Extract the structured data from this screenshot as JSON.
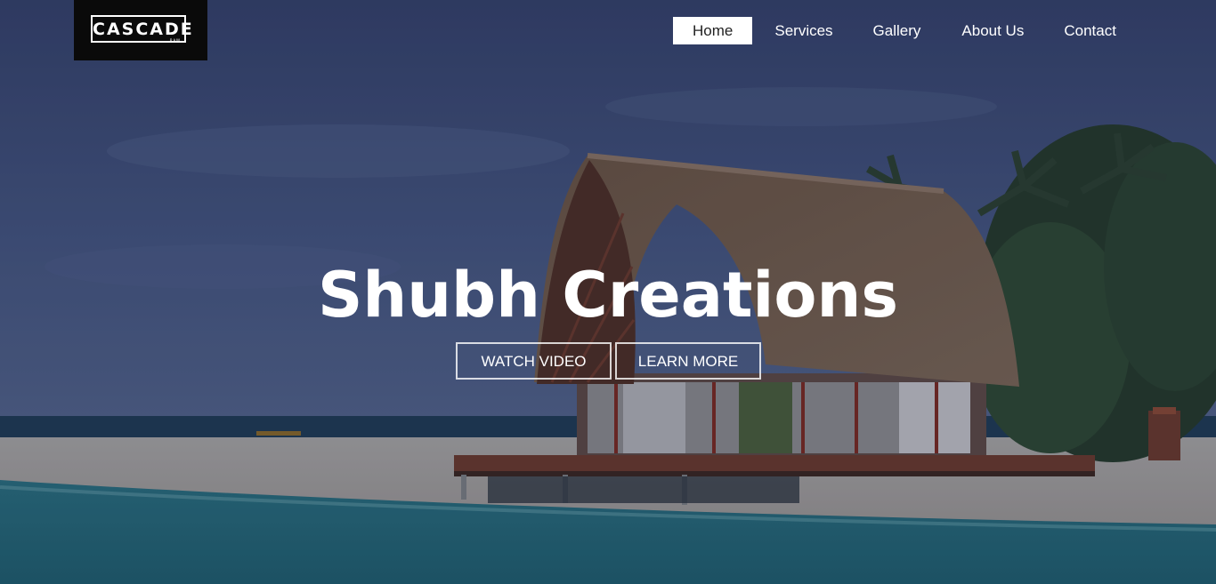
{
  "brand": {
    "logo_text": "CASCADE",
    "logo_subtext": "RAW"
  },
  "nav": {
    "items": [
      {
        "label": "Home",
        "active": true
      },
      {
        "label": "Services",
        "active": false
      },
      {
        "label": "Gallery",
        "active": false
      },
      {
        "label": "About Us",
        "active": false
      },
      {
        "label": "Contact",
        "active": false
      }
    ]
  },
  "hero": {
    "title": "Shubh Creations",
    "watch_video_label": "WATCH VIDEO",
    "learn_more_label": "LEARN MORE",
    "background_description": "beach-hut-photo"
  },
  "colors": {
    "logo_bg": "#0a0a0a",
    "nav_active_bg": "#ffffff",
    "text_primary": "#ffffff",
    "sky": "#3e4d78",
    "sea": "#2e7f8a",
    "sand": "#b9b4ad",
    "thatch": "#6b5a4a"
  }
}
